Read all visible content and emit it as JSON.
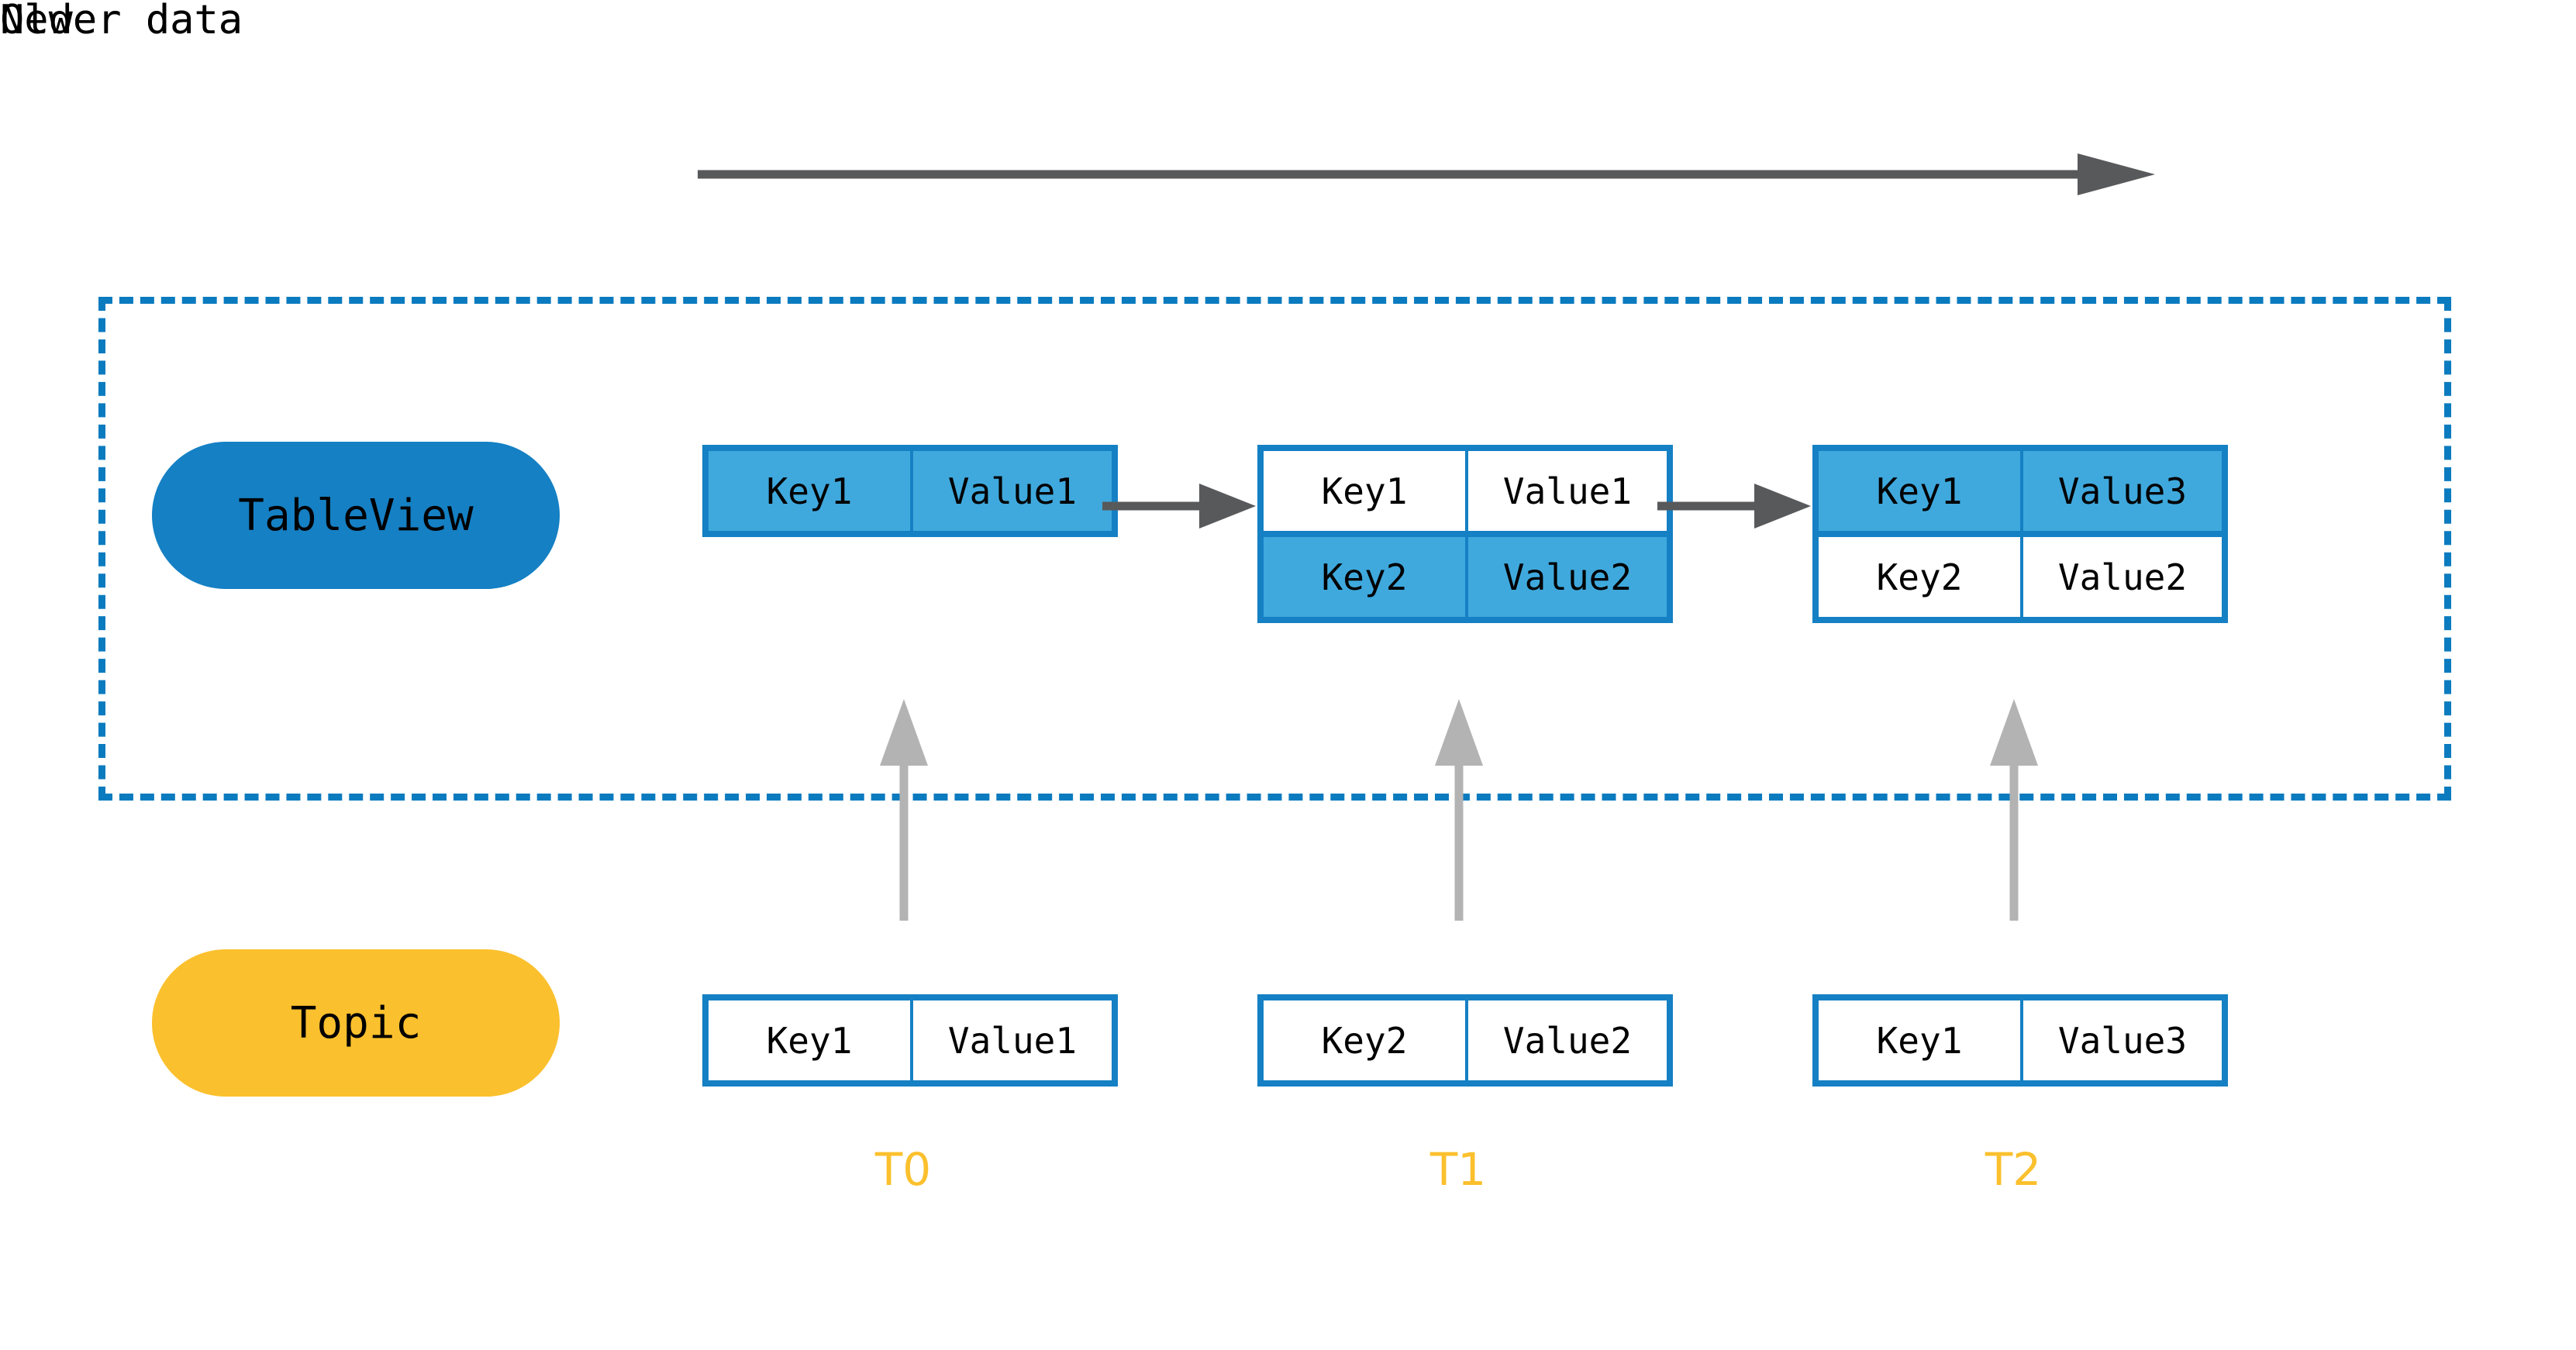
{
  "diagram": {
    "timeline": {
      "older_label": "Older data",
      "newer_label": "Newer data",
      "arrow_direction": "left-to-right",
      "arrow_color": "#58595B"
    },
    "lanes": [
      {
        "id": "tableview",
        "pill_label": "TableView",
        "pill_color": "#1580C4",
        "bordered": true,
        "border_color": "#0B7BBF",
        "border_style": "dashed"
      },
      {
        "id": "topic",
        "pill_label": "Topic",
        "pill_color": "#FBC02D",
        "bordered": false
      }
    ],
    "colors": {
      "accent_blue": "#1580C4",
      "highlight_blue": "#3FA9DD",
      "dashed_blue": "#0B7BBF",
      "amber": "#FBC02D",
      "arrow_gray": "#58595B",
      "ingest_gray": "#B3B3B3"
    },
    "tableview_states": [
      {
        "time": "T0",
        "rows": [
          {
            "key": "Key1",
            "value": "Value1",
            "highlight": true
          }
        ]
      },
      {
        "time": "T1",
        "rows": [
          {
            "key": "Key1",
            "value": "Value1",
            "highlight": false
          },
          {
            "key": "Key2",
            "value": "Value2",
            "highlight": true
          }
        ]
      },
      {
        "time": "T2",
        "rows": [
          {
            "key": "Key1",
            "value": "Value3",
            "highlight": true
          },
          {
            "key": "Key2",
            "value": "Value2",
            "highlight": false
          }
        ]
      }
    ],
    "topic_records": [
      {
        "time": "T0",
        "key": "Key1",
        "value": "Value1"
      },
      {
        "time": "T1",
        "key": "Key2",
        "value": "Value2"
      },
      {
        "time": "T2",
        "key": "Key1",
        "value": "Value3"
      }
    ],
    "time_markers": [
      "T0",
      "T1",
      "T2"
    ]
  }
}
